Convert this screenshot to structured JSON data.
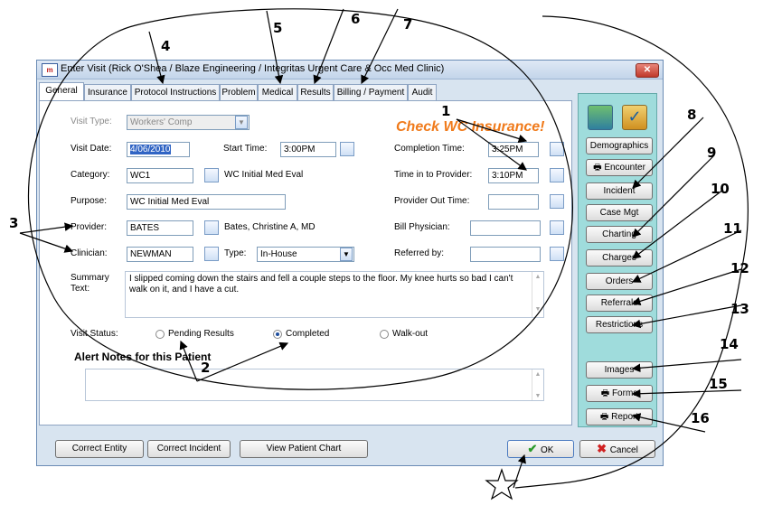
{
  "window": {
    "title": "Enter Visit (Rick O'Shea / Blaze Engineering / Integritas Urgent Care & Occ Med Clinic)",
    "close_glyph": "✕"
  },
  "tabs": [
    "General",
    "Insurance",
    "Protocol Instructions",
    "Problem",
    "Medical",
    "Results",
    "Billing / Payment",
    "Audit"
  ],
  "form": {
    "visit_type_label": "Visit Type:",
    "visit_type_value": "Workers' Comp",
    "visit_date_label": "Visit Date:",
    "visit_date_value": "4/06/2010",
    "start_time_label": "Start Time:",
    "start_time_value": "3:00PM",
    "category_label": "Category:",
    "category_value": "WC1",
    "category_desc": "WC  Initial Med Eval",
    "purpose_label": "Purpose:",
    "purpose_value": "WC  Initial Med Eval",
    "provider_label": "Provider:",
    "provider_value": "BATES",
    "provider_desc": "Bates, Christine A, MD",
    "clinician_label": "Clinician:",
    "clinician_value": "NEWMAN",
    "type_label": "Type:",
    "type_value": "In-House",
    "completion_time_label": "Completion Time:",
    "completion_time_value": "3:25PM",
    "time_in_label": "Time in to Provider:",
    "time_in_value": "3:10PM",
    "provider_out_label": "Provider Out Time:",
    "bill_physician_label": "Bill Physician:",
    "referred_by_label": "Referred by:",
    "summary_label_1": "Summary",
    "summary_label_2": "Text:",
    "summary_text": "I slipped coming down the stairs and fell a couple steps to the floor.  My knee hurts so bad I can't walk on it, and I have a cut.",
    "visit_status_label": "Visit Status:",
    "status_options": [
      "Pending Results",
      "Completed",
      "Walk-out"
    ],
    "alert_notes_label": "Alert Notes for this Patient",
    "warning": "Check WC Insurance!"
  },
  "right_buttons": [
    "Demographics",
    "Encounter",
    "Incident",
    "Case Mgt",
    "Charting",
    "Charges",
    "Orders",
    "Referrals",
    "Restrictions",
    "Images",
    "Forms",
    "Report"
  ],
  "bottom_buttons": {
    "correct_entity": "Correct Entity",
    "correct_incident": "Correct Incident",
    "view_chart": "View Patient Chart",
    "ok": "OK",
    "cancel": "Cancel"
  },
  "callouts": [
    "1",
    "1",
    "2",
    "3",
    "4",
    "5",
    "6",
    "7",
    "8",
    "9",
    "10",
    "11",
    "12",
    "13",
    "14",
    "15",
    "16"
  ],
  "colors": {
    "warning": "#f07a1a",
    "right_panel": "#9fdcdc",
    "window_bg": "#d8e4f0"
  }
}
